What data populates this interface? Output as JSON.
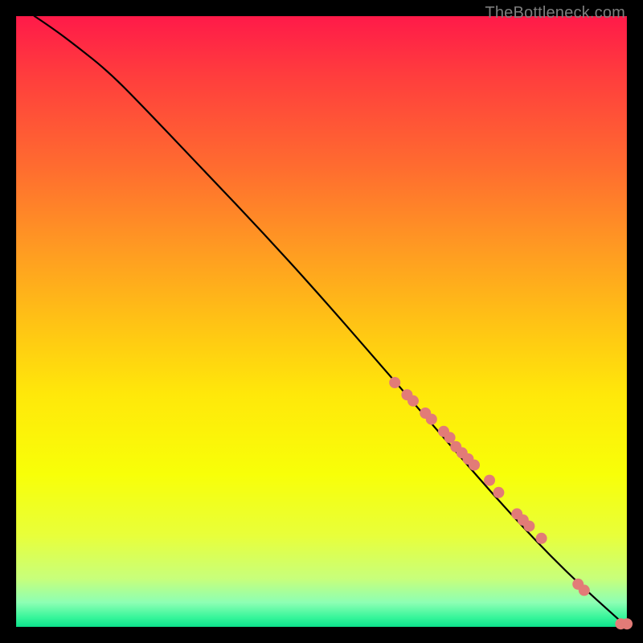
{
  "watermark": "TheBottleneck.com",
  "colors": {
    "bg": "#000000",
    "dot": "#e27b77",
    "curve": "#000000",
    "gradient_top": "#ff1a49",
    "gradient_bottom": "#0ce28c"
  },
  "chart_data": {
    "type": "line",
    "title": "",
    "xlabel": "",
    "ylabel": "",
    "xlim": [
      0,
      100
    ],
    "ylim": [
      0,
      100
    ],
    "grid": false,
    "curve": {
      "x": [
        3,
        6,
        10,
        15,
        20,
        30,
        40,
        50,
        60,
        70,
        80,
        90,
        100
      ],
      "y": [
        100,
        98,
        95,
        91,
        86,
        75.5,
        65,
        54,
        42.5,
        31,
        19.5,
        9,
        0
      ]
    },
    "series": [
      {
        "name": "points",
        "x": [
          62,
          64,
          65,
          67,
          68,
          70,
          71,
          72,
          73,
          74,
          75,
          77.5,
          79,
          82,
          83,
          84,
          86,
          92,
          93,
          99,
          100
        ],
        "y": [
          40,
          38,
          37,
          35,
          34,
          32,
          31,
          29.5,
          28.5,
          27.5,
          26.5,
          24,
          22,
          18.5,
          17.5,
          16.5,
          14.5,
          7,
          6,
          0.5,
          0.5
        ]
      }
    ],
    "dot_radius_px": 7
  }
}
